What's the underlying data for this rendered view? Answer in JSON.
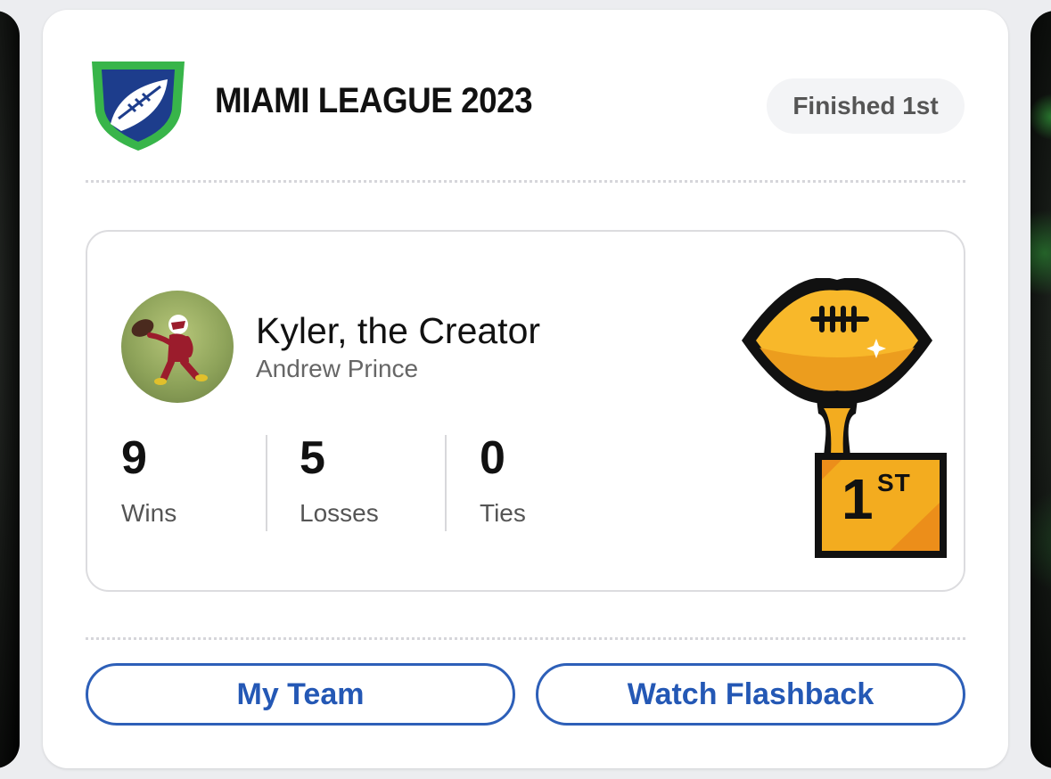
{
  "league": {
    "title": "MIAMI LEAGUE 2023",
    "finish_badge": "Finished 1st",
    "logo_icon": "football-shield-logo-icon"
  },
  "team": {
    "name": "Kyler, the Creator",
    "owner": "Andrew Prince",
    "avatar": "team-avatar-football-player"
  },
  "stats": [
    {
      "value": "9",
      "label": "Wins"
    },
    {
      "value": "5",
      "label": "Losses"
    },
    {
      "value": "0",
      "label": "Ties"
    }
  ],
  "trophy": {
    "icon": "championship-trophy-icon",
    "place": "1",
    "place_suffix": "ST"
  },
  "actions": {
    "my_team": "My Team",
    "watch_flashback": "Watch Flashback"
  },
  "colors": {
    "accent_blue": "#2458b5",
    "logo_green": "#38b54a",
    "logo_navy": "#1d3d8c",
    "trophy_gold": "#f3ac1f"
  }
}
